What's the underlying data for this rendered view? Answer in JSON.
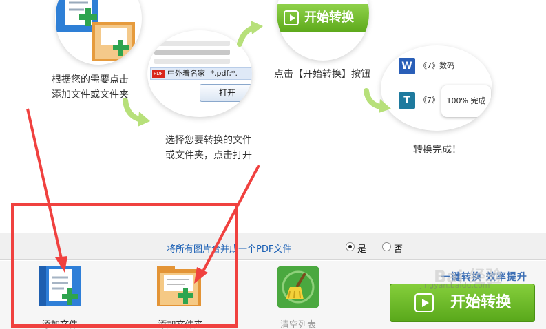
{
  "steps": {
    "step1_caption_line1": "根据您的需要点击",
    "step1_caption_line2": "添加文件或文件夹",
    "step2_caption_line1": "选择您要转换的文件",
    "step2_caption_line2": "或文件夹，点击打开",
    "step3_caption": "点击【开始转换】按钮",
    "step4_caption": "转换完成！",
    "dialog_pdf_tag": "PDF",
    "dialog_file_name": "中外着名家",
    "dialog_filter": "*.pdf;*.",
    "dialog_open_label": "打开",
    "mini_start_label": "开始转换",
    "done_doc1_icon": "W",
    "done_doc1_name": "《7》数码",
    "done_doc2_icon": "T",
    "done_doc2_name": "《7》",
    "done_progress": "100%  完成"
  },
  "options": {
    "merge_label": "将所有图片合并成一个PDF文件",
    "yes_label": "是",
    "no_label": "否",
    "selected": "是"
  },
  "toolbar": {
    "add_file_label": "添加文件",
    "add_folder_label": "添加文件夹",
    "clear_list_label": "清空列表",
    "slogan": "一键转换  效率提升",
    "start_label": "开始转换"
  },
  "watermark": {
    "brand": "Bai 经验",
    "url": "jingyan.baidu.com"
  },
  "colors": {
    "accent_green": "#6cbf2a",
    "link_blue": "#1a5fb4",
    "annotation_red": "#f0413f"
  }
}
